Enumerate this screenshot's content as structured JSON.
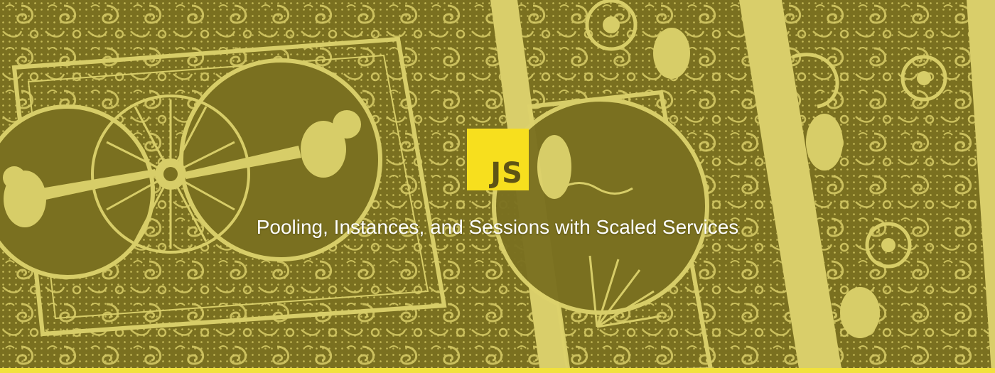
{
  "hero": {
    "title": "Pooling, Instances, and Sessions with Scaled Services",
    "logo_text": "JS"
  },
  "colors": {
    "background_dark": "#7a7020",
    "ornament_light": "#ddd26c",
    "logo_background": "#f7df1e",
    "logo_text": "#5f5415",
    "title_text": "#ffffff",
    "bottom_bar": "#f2e23c"
  },
  "icons": {
    "logo": "js-logo-icon"
  }
}
